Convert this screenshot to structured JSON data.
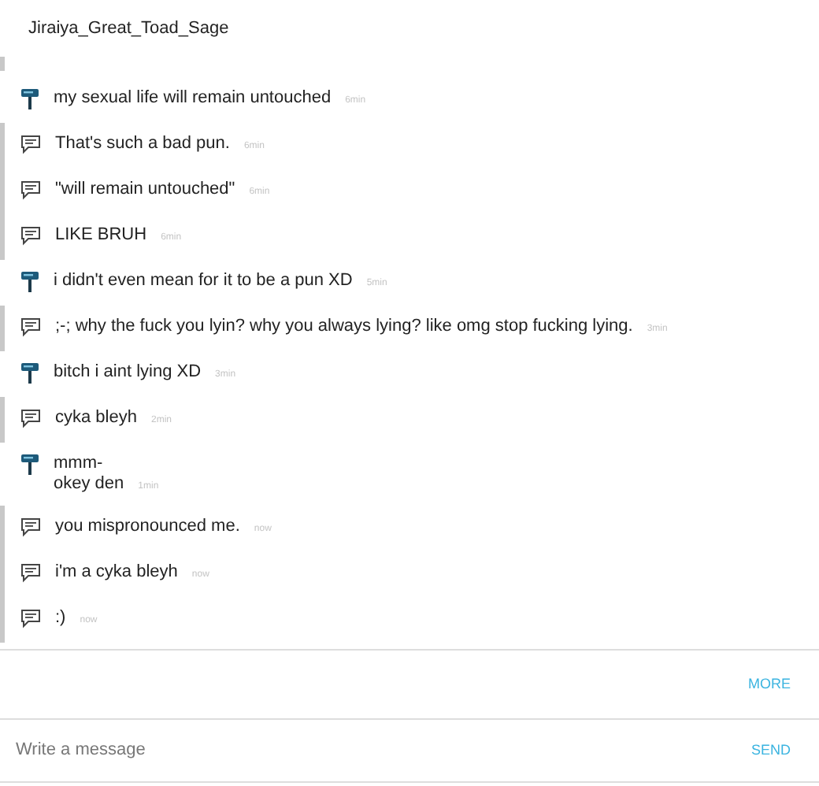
{
  "header": {
    "title": "Jiraiya_Great_Toad_Sage"
  },
  "messages": [
    {
      "kind": "toad",
      "lines": [
        "my sexual life will remain untouched"
      ],
      "time": "6min"
    },
    {
      "kind": "lol",
      "lines": [
        "That's such a bad pun."
      ],
      "time": "6min"
    },
    {
      "kind": "lol",
      "lines": [
        "\"will remain untouched\""
      ],
      "time": "6min"
    },
    {
      "kind": "lol",
      "lines": [
        "LIKE BRUH"
      ],
      "time": "6min"
    },
    {
      "kind": "toad",
      "lines": [
        "i didn't even mean for it to be a pun XD"
      ],
      "time": "5min"
    },
    {
      "kind": "lol",
      "lines": [
        ";-; why the fuck you lyin? why you always lying? like omg stop fucking lying."
      ],
      "time": "3min"
    },
    {
      "kind": "toad",
      "lines": [
        "bitch i aint lying XD"
      ],
      "time": "3min"
    },
    {
      "kind": "lol",
      "lines": [
        "cyka bleyh"
      ],
      "time": "2min"
    },
    {
      "kind": "toad",
      "lines": [
        "mmm-",
        "okey den"
      ],
      "time": "1min"
    },
    {
      "kind": "lol",
      "lines": [
        "you mispronounced me."
      ],
      "time": "now"
    },
    {
      "kind": "lol",
      "lines": [
        "i'm a cyka bleyh"
      ],
      "time": "now"
    },
    {
      "kind": "lol",
      "lines": [
        ":)"
      ],
      "time": "now"
    }
  ],
  "more_button": "MORE",
  "composer": {
    "placeholder": "Write a message",
    "send_button": "SEND"
  }
}
